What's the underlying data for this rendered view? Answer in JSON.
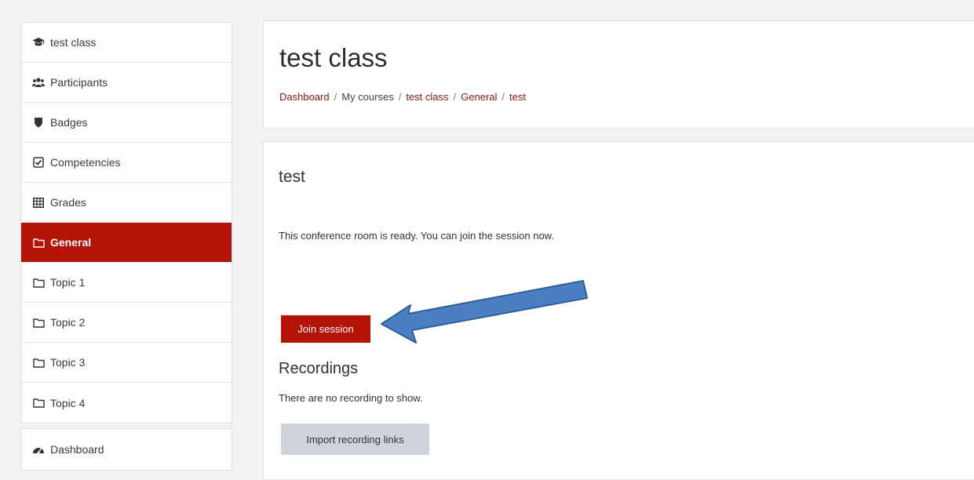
{
  "sidebar": {
    "items": [
      {
        "label": "test class",
        "icon": "graduation-cap-icon",
        "active": false
      },
      {
        "label": "Participants",
        "icon": "users-icon",
        "active": false
      },
      {
        "label": "Badges",
        "icon": "shield-icon",
        "active": false
      },
      {
        "label": "Competencies",
        "icon": "check-square-icon",
        "active": false
      },
      {
        "label": "Grades",
        "icon": "table-icon",
        "active": false
      },
      {
        "label": "General",
        "icon": "folder-icon",
        "active": true
      },
      {
        "label": "Topic 1",
        "icon": "folder-icon",
        "active": false
      },
      {
        "label": "Topic 2",
        "icon": "folder-icon",
        "active": false
      },
      {
        "label": "Topic 3",
        "icon": "folder-icon",
        "active": false
      },
      {
        "label": "Topic 4",
        "icon": "folder-icon",
        "active": false
      }
    ],
    "secondary": [
      {
        "label": "Dashboard",
        "icon": "dashboard-icon"
      }
    ]
  },
  "header": {
    "title": "test class",
    "breadcrumb": [
      "Dashboard",
      "My courses",
      "test class",
      "General",
      "test"
    ]
  },
  "main": {
    "activity_title": "test",
    "status": "This conference room is ready. You can join the session now.",
    "join_label": "Join session",
    "recordings_title": "Recordings",
    "recordings_empty": "There are no recording to show.",
    "import_label": "Import recording links"
  },
  "colors": {
    "accent": "#b51208",
    "annotation_arrow": "#4a7fc4",
    "secondary_button": "#ced4da"
  }
}
